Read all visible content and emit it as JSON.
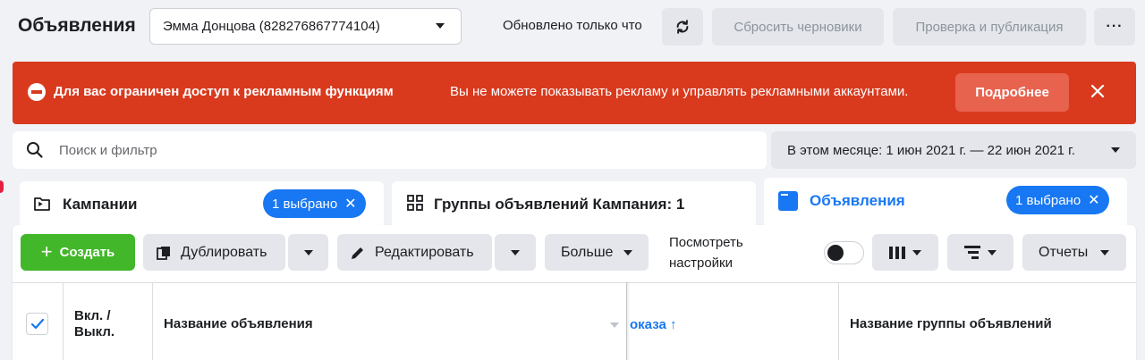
{
  "header": {
    "title": "Объявления",
    "account": "Эмма Донцова (828276867774104)",
    "updated": "Обновлено только что",
    "discard_label": "Сбросить черновики",
    "publish_label": "Проверка и публикация",
    "more_label": "···"
  },
  "banner": {
    "title": "Для вас ограничен доступ к рекламным функциям",
    "text": "Вы не можете показывать рекламу и управлять рекламными аккаунтами.",
    "details_label": "Подробнее",
    "color": "#d93a1e"
  },
  "search": {
    "placeholder": "Поиск и фильтр"
  },
  "date_range": {
    "label": "В этом месяце: 1 июн 2021 г. — 22 июн 2021 г."
  },
  "tabs": {
    "campaigns": {
      "label": "Кампании",
      "badge": "1 выбрано"
    },
    "adsets": {
      "label": "Группы объявлений Кампания: 1"
    },
    "ads": {
      "label": "Объявления",
      "badge": "1 выбрано"
    }
  },
  "toolbar": {
    "create_label": "Создать",
    "duplicate_label": "Дублировать",
    "edit_label": "Редактировать",
    "more_label": "Больше",
    "view_settings_label": "Посмотреть настройки",
    "reports_label": "Отчеты"
  },
  "table": {
    "columns": {
      "onoff": "Вкл. / Выкл.",
      "ad_name": "Название объявления",
      "delivery": "оказа",
      "adset_name": "Название группы объявлений"
    }
  },
  "colors": {
    "accent": "#1877f2",
    "create": "#42b72a"
  }
}
